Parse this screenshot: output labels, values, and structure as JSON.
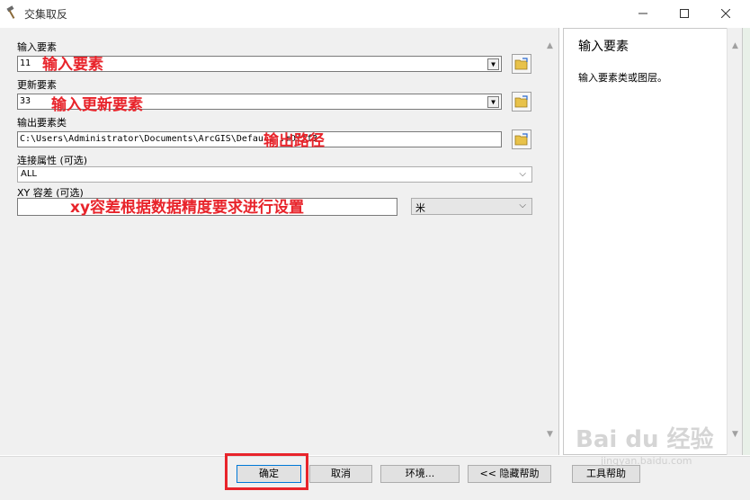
{
  "window": {
    "title": "交集取反",
    "icon": "hammer-icon"
  },
  "form": {
    "input_features": {
      "label": "输入要素",
      "value": "11"
    },
    "update_features": {
      "label": "更新要素",
      "value": "33"
    },
    "output_feature_class": {
      "label": "输出要素类",
      "value": "C:\\Users\\Administrator\\Documents\\ArcGIS\\Defaul...mDiff3"
    },
    "join_attributes": {
      "label": "连接属性 (可选)",
      "value": "ALL"
    },
    "xy_tolerance": {
      "label": "XY 容差 (可选)",
      "value": "",
      "unit": "米"
    }
  },
  "annotations": {
    "input": "输入要素",
    "update": "输入更新要素",
    "output": "输出路径",
    "xy": "xy容差根据数据精度要求进行设置"
  },
  "help": {
    "title": "输入要素",
    "text": "输入要素类或图层。"
  },
  "buttons": {
    "ok": "确定",
    "cancel": "取消",
    "environments": "环境...",
    "hide_help": "<< 隐藏帮助",
    "tool_help": "工具帮助"
  },
  "watermark": {
    "logo": "Bai du 经验",
    "sub": "jingyan.baidu.com"
  },
  "colors": {
    "annotation": "#e8242b",
    "highlight_box": "#e8242b",
    "ok_border": "#0078d7"
  }
}
